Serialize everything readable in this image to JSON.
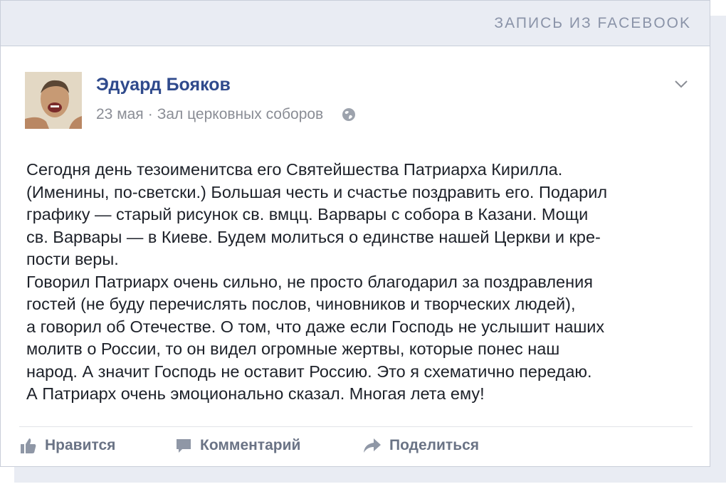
{
  "header": {
    "label": "ЗАПИСЬ ИЗ FACEBOOK"
  },
  "post": {
    "author": "Эдуард Бояков",
    "date": "23 мая",
    "separator": "·",
    "location": "Зал церковных соборов",
    "lines": [
      "Сегодня день тезоименитсва его Святейшества Патриарха Кирилла.",
      "(Именины, по-светски.) Большая честь и счастье поздравить его. Подарил",
      "графику — старый рисунок св. вмцц. Варвары с собора в Казани. Мощи",
      "св. Варвары — в Киеве. Будем молиться о единстве нашей Церкви и кре-",
      "пости веры.",
      "Говорил Патриарх очень сильно, не просто благодарил за поздравления",
      "гостей (не буду перечислять послов, чиновников и творческих людей),",
      "а говорил об Отечестве. О том, что даже если Господь не услышит наших",
      "молитв о России, то он видел огромные жертвы, которые понес наш",
      "народ. А значит Господь не оставит Россию. Это я схематично передаю.",
      "А Патриарх очень эмоционально сказал. Многая лета ему!"
    ]
  },
  "actions": {
    "like": "Нравится",
    "comment": "Комментарий",
    "share": "Поделиться"
  },
  "icons": {
    "avatar": "profile-photo",
    "chevron": "chevron-down-icon",
    "globe": "globe-icon",
    "like": "thumbs-up-icon",
    "comment": "comment-icon",
    "share": "share-arrow-icon"
  },
  "colors": {
    "author": "#2f4a8c",
    "header_bg": "#e9ecf3",
    "action_text": "#6a7385",
    "meta_text": "#8a8d95"
  }
}
